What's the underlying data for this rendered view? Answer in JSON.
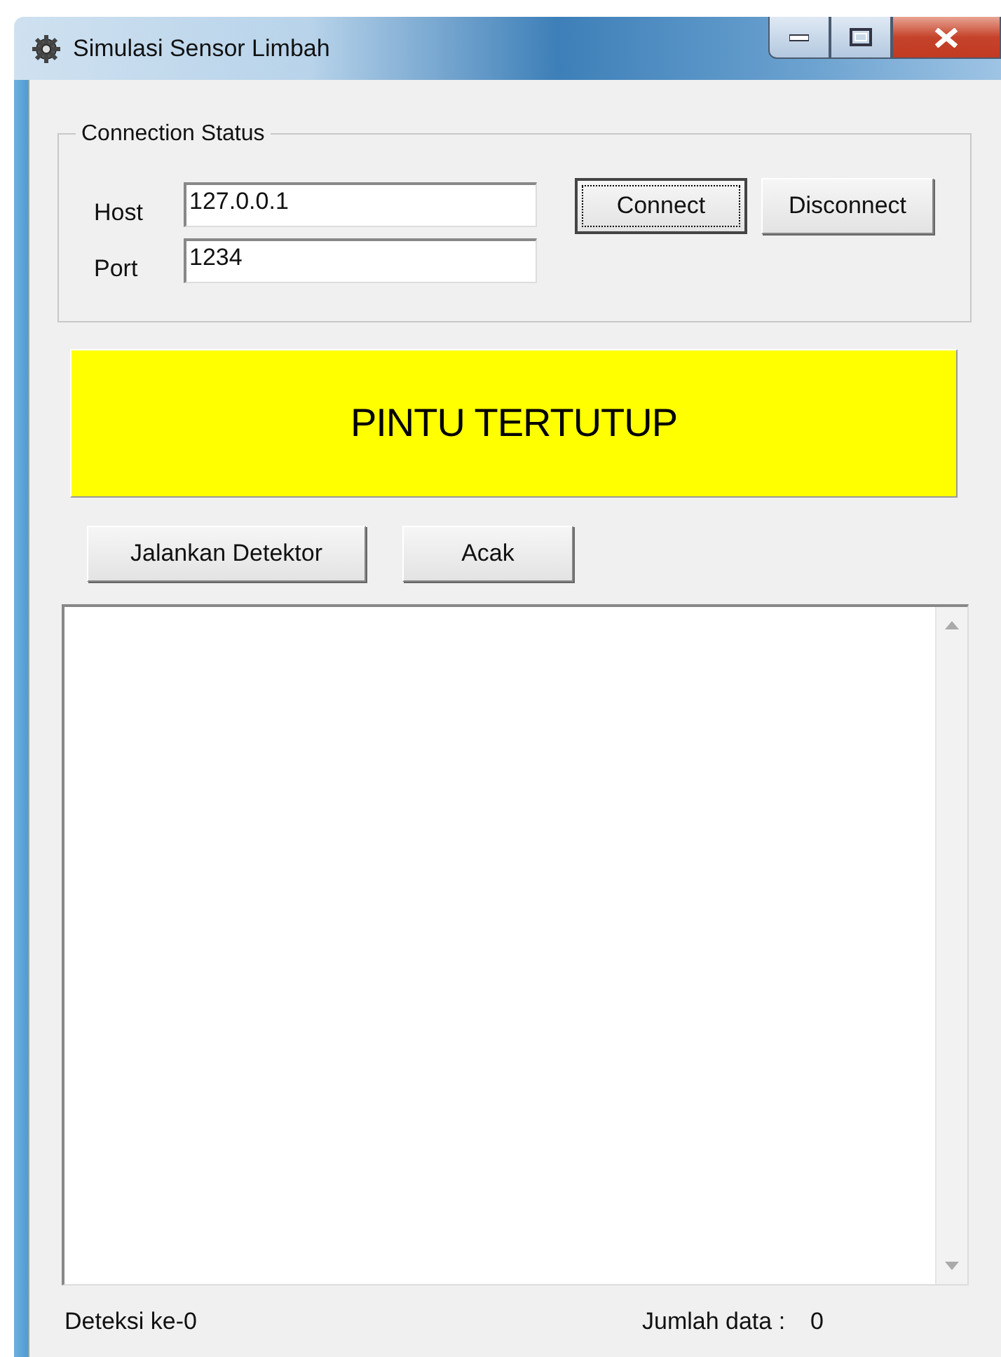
{
  "window": {
    "title": "Simulasi Sensor Limbah"
  },
  "connection": {
    "title": "Connection Status",
    "fields": [
      {
        "label": "Host",
        "value": "127.0.0.1"
      },
      {
        "label": "Port",
        "value": "1234"
      }
    ],
    "buttons": [
      {
        "label": "Connect",
        "focused": true
      },
      {
        "label": "Disconnect",
        "focused": false
      }
    ]
  },
  "door_status": {
    "text": "PINTU TERTUTUP"
  },
  "actions": [
    "Jalankan Detektor",
    "Acak"
  ],
  "status_bar": {
    "detection": "Deteksi ke-0",
    "count_label": "Jumlah data :",
    "count": "0"
  }
}
